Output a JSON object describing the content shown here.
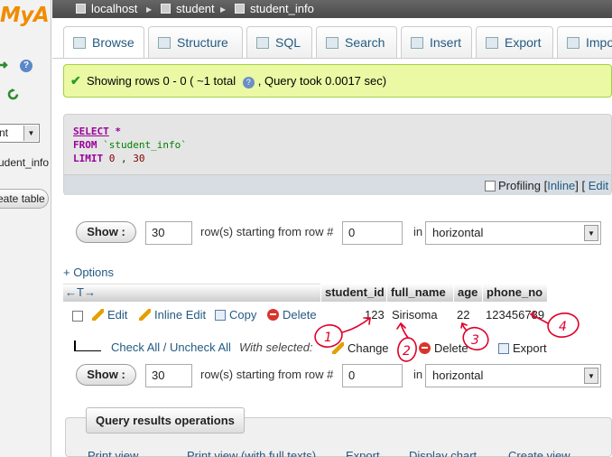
{
  "sidebar": {
    "logo_text": "MyA",
    "db_select_value": "nt",
    "table_item": "udent_info",
    "create_table_label": "eate table"
  },
  "breadcrumb": {
    "server": "localhost",
    "database": "student",
    "table": "student_info"
  },
  "tabs": [
    {
      "label": "Browse",
      "icon": "browse-icon"
    },
    {
      "label": "Structure",
      "icon": "structure-icon"
    },
    {
      "label": "SQL",
      "icon": "sql-icon"
    },
    {
      "label": "Search",
      "icon": "search-icon"
    },
    {
      "label": "Insert",
      "icon": "insert-icon"
    },
    {
      "label": "Export",
      "icon": "export-icon"
    },
    {
      "label": "Impo",
      "icon": "import-icon"
    }
  ],
  "message": {
    "text_before": "Showing rows 0 - 0 ( ~1 total",
    "text_after": ", Query took 0.0017 sec)"
  },
  "sql": {
    "line1_kw": "SELECT",
    "line1_rest": " *",
    "line2_kw": "FROM",
    "line2_rest": " `student_info`",
    "line3_kw": "LIMIT",
    "line3_a": " 0",
    "line3_sep": " ,",
    "line3_b": " 30",
    "profiling_label": "Profiling",
    "inline_label": "Inline",
    "edit_label": "Edit"
  },
  "navigation": {
    "show_label": "Show :",
    "rows_value": "30",
    "rows_text": "row(s) starting from row #",
    "start_value": "0",
    "in_label": "in",
    "mode_value": "horizontal"
  },
  "options_label": "+ Options",
  "table": {
    "columns": [
      "student_id",
      "full_name",
      "age",
      "phone_no"
    ],
    "row": {
      "student_id": "123",
      "full_name": "Sirisoma",
      "age": "22",
      "phone_no": "123456789"
    },
    "actions": {
      "edit": "Edit",
      "inline_edit": "Inline Edit",
      "copy": "Copy",
      "delete": "Delete"
    }
  },
  "with_selected": {
    "check_all": "Check All / Uncheck All",
    "label": "With selected:",
    "change": "Change",
    "delete": "Delete",
    "export": "Export"
  },
  "results_operations": {
    "legend": "Query results operations",
    "links": [
      "Print view",
      "Print view (with full texts)",
      "Export",
      "Display chart",
      "Create view"
    ]
  },
  "annotations": [
    "1",
    "2",
    "3",
    "4"
  ],
  "colors": {
    "success_bg": "#ebf8a4",
    "link": "#235a81",
    "sql_keyword": "#990099",
    "annotation": "#e0002a"
  }
}
